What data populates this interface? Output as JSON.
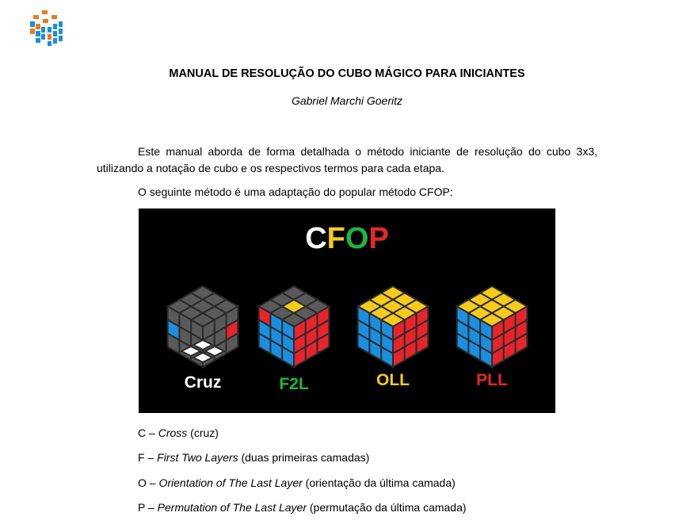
{
  "colors": {
    "blue": "#1a8fe0",
    "orange": "#f07820",
    "red": "#e8242a",
    "yellow": "#f6cb1a",
    "green": "#1db63f",
    "white": "#ffffff",
    "gray": "#5a5a5a"
  },
  "logo": {
    "icon": "rubiks-cube-logo-icon"
  },
  "doc": {
    "title": "MANUAL DE RESOLUÇÃO DO CUBO MÁGICO PARA INICIANTES",
    "author": "Gabriel Marchi Goeritz",
    "paragraph1": "Este manual aborda de forma detalhada o método iniciante de resolução do cubo 3x3, utilizando a notação de cubo e os respectivos termos para cada etapa.",
    "paragraph2": "O seguinte método é uma adaptação do popular método CFOP:"
  },
  "figure": {
    "title_letters": [
      {
        "letter": "C",
        "color": "#ffffff"
      },
      {
        "letter": "F",
        "color": "#f6cb1a"
      },
      {
        "letter": "O",
        "color": "#1db63f"
      },
      {
        "letter": "P",
        "color": "#e8242a"
      }
    ],
    "stages": [
      {
        "label": "Cruz",
        "color": "#ffffff"
      },
      {
        "label": "F2L",
        "color": "#1db63f"
      },
      {
        "label": "OLL",
        "color": "#f6cb1a"
      },
      {
        "label": "PLL",
        "color": "#e8242a"
      }
    ]
  },
  "steps": [
    {
      "letter": "C",
      "dash": " – ",
      "term": "Cross",
      "desc": " (cruz)"
    },
    {
      "letter": "F",
      "dash": " – ",
      "term": "First Two Layers",
      "desc": " (duas primeiras camadas)"
    },
    {
      "letter": "O",
      "dash": " – ",
      "term": "Orientation of The Last Layer",
      "desc": " (orientação da última camada)"
    },
    {
      "letter": "P",
      "dash": " – ",
      "term": "Permutation of The Last Layer",
      "desc": " (permutação da última camada)"
    }
  ]
}
